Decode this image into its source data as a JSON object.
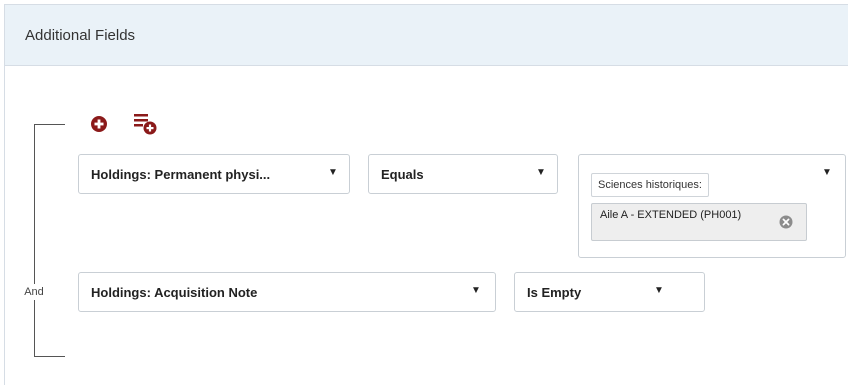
{
  "panel": {
    "title": "Additional Fields"
  },
  "group": {
    "operator_label": "And"
  },
  "rows": [
    {
      "field": "Holdings: Permanent physi...",
      "operator": "Equals",
      "value_prefix": "Sciences historiques:",
      "selected_values": [
        "Aile A - EXTENDED (PH001)"
      ]
    },
    {
      "field": "Holdings: Acquisition Note",
      "operator": "Is Empty"
    }
  ],
  "icons": {
    "add": "plus-circle-icon",
    "add_group": "add-group-icon",
    "caret": "caret-down-icon",
    "remove": "remove-circle-icon"
  },
  "colors": {
    "accent": "#8b1a1a",
    "header_bg": "#eaf2f8",
    "border": "#c9cfd5",
    "chip_bg": "#eeeeee"
  }
}
